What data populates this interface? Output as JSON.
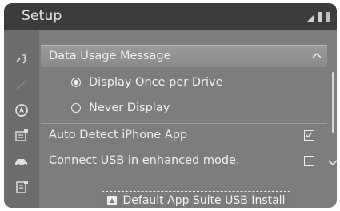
{
  "header": {
    "title": "Setup",
    "status_icons": [
      "signal-icon",
      "battery-icon",
      "battery-icon"
    ]
  },
  "sidebar": {
    "icons": [
      "phone-settings-icon",
      "navigation-icon",
      "audio-icon",
      "apps-icon",
      "car-icon",
      "memo-icon"
    ]
  },
  "section": {
    "label": "Data Usage Message",
    "expanded": true
  },
  "radio_options": [
    {
      "label": "Display Once per Drive",
      "selected": true
    },
    {
      "label": "Never Display",
      "selected": false
    }
  ],
  "settings_rows": [
    {
      "label": "Auto Detect iPhone App",
      "checked": true
    },
    {
      "label": "Connect USB in enhanced mode.",
      "checked": false
    }
  ],
  "footer": {
    "button_label": "Default App Suite USB Install",
    "button_icon": "app-suite-icon"
  },
  "colors": {
    "background": "#7d7d7d",
    "header": "#3c3c3c",
    "text": "#f0f0f0"
  }
}
